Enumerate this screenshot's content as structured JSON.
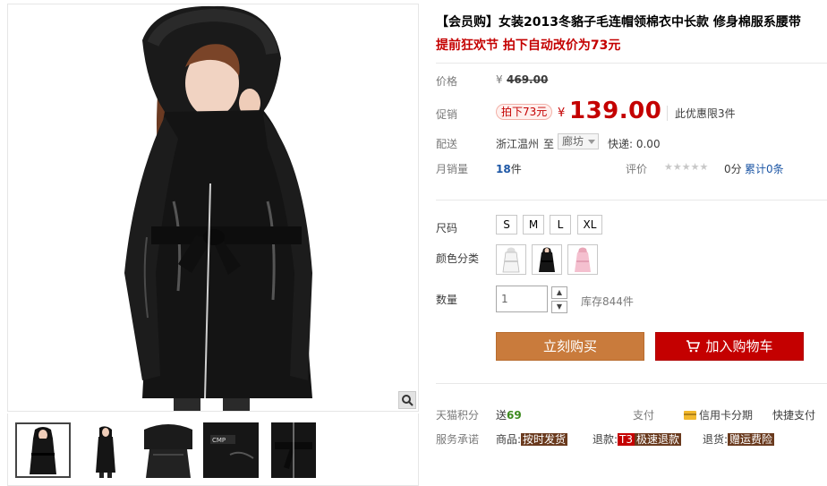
{
  "product": {
    "title": "【会员购】女装2013冬貉子毛连帽领棉衣中长款 修身棉服系腰带",
    "subtitle": "提前狂欢节 拍下自动改价为73元"
  },
  "price": {
    "label": "价格",
    "currency": "¥",
    "original": "469.00"
  },
  "promo": {
    "label": "促销",
    "tag": "拍下73元",
    "currency": "¥",
    "price": "139.00",
    "limit": "此优惠限3件"
  },
  "shipping": {
    "label": "配送",
    "from": "浙江温州",
    "to_word": "至",
    "city": "廊坊",
    "fee": "快递: 0.00"
  },
  "sales": {
    "label": "月销量",
    "count": "18",
    "unit": "件",
    "rating_label": "评价",
    "stars": "★★★★★",
    "score": "0分",
    "total": "累计0条"
  },
  "size": {
    "label": "尺码",
    "options": [
      "S",
      "M",
      "L",
      "XL"
    ]
  },
  "color": {
    "label": "颜色分类",
    "options": [
      "white-coat",
      "black-coat",
      "pink-coat"
    ]
  },
  "quantity": {
    "label": "数量",
    "value": "1",
    "stock": "库存844件",
    "up": "▲",
    "down": "▼"
  },
  "actions": {
    "buy_now": "立刻购买",
    "add_cart": "加入购物车"
  },
  "points": {
    "label": "天猫积分",
    "prefix": "送",
    "value": "69",
    "pay_label": "支付",
    "installment": "信用卡分期",
    "quick_pay": "快捷支付"
  },
  "service": {
    "label": "服务承诺",
    "goods": "商品:",
    "goods_badge": "按时发货",
    "refund": "退款:",
    "refund_t3": "T3",
    "refund_badge": "极速退款",
    "return": "退货:",
    "return_badge": "赠运费险"
  },
  "colors": {
    "accent_red": "#c40000",
    "buy_orange": "#c97b3c",
    "link_blue": "#1c56a5"
  }
}
